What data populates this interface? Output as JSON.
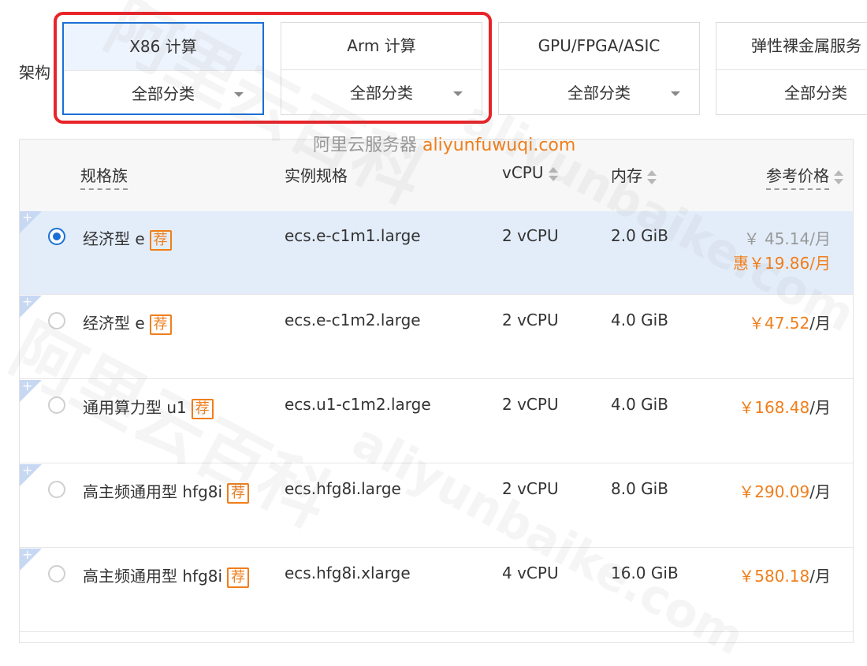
{
  "architecture": {
    "label": "架构",
    "tabs": [
      {
        "title": "X86 计算",
        "category": "全部分类",
        "active": true
      },
      {
        "title": "Arm 计算",
        "category": "全部分类",
        "active": false
      },
      {
        "title": "GPU/FPGA/ASIC",
        "category": "全部分类",
        "active": false
      },
      {
        "title": "弹性裸金属服务",
        "category": "全部分类",
        "active": false
      }
    ]
  },
  "watermark": {
    "text": "阿里云服务器",
    "url": "aliyunfuwuqi.com",
    "big_cn": "阿里云百科",
    "big_en": "aliyunbaike.com"
  },
  "table": {
    "headers": {
      "family": "规格族",
      "spec": "实例规格",
      "vcpu": "vCPU",
      "memory": "内存",
      "price": "参考价格"
    },
    "recommend_badge": "荐",
    "rows": [
      {
        "family": "经济型 e",
        "spec": "ecs.e-c1m1.large",
        "vcpu": "2 vCPU",
        "memory": "2.0 GiB",
        "price_symbol": "￥",
        "price": "45.14",
        "price_unit": "/月",
        "promo": "惠￥19.86/月",
        "selected": true
      },
      {
        "family": "经济型 e",
        "spec": "ecs.e-c1m2.large",
        "vcpu": "2 vCPU",
        "memory": "4.0 GiB",
        "price_symbol": "￥",
        "price": "47.52",
        "price_unit": "/月",
        "promo": "",
        "selected": false
      },
      {
        "family": "通用算力型 u1",
        "spec": "ecs.u1-c1m2.large",
        "vcpu": "2 vCPU",
        "memory": "4.0 GiB",
        "price_symbol": "￥",
        "price": "168.48",
        "price_unit": "/月",
        "promo": "",
        "selected": false
      },
      {
        "family": "高主频通用型 hfg8i",
        "spec": "ecs.hfg8i.large",
        "vcpu": "2 vCPU",
        "memory": "8.0 GiB",
        "price_symbol": "￥",
        "price": "290.09",
        "price_unit": "/月",
        "promo": "",
        "selected": false
      },
      {
        "family": "高主频通用型 hfg8i",
        "spec": "ecs.hfg8i.xlarge",
        "vcpu": "4 vCPU",
        "memory": "16.0 GiB",
        "price_symbol": "￥",
        "price": "580.18",
        "price_unit": "/月",
        "promo": "",
        "selected": false
      }
    ]
  },
  "colors": {
    "accent": "#1a6fd6",
    "price_orange": "#f07e1b",
    "highlight_red": "#e8232a",
    "selected_row": "#e3edfa"
  }
}
